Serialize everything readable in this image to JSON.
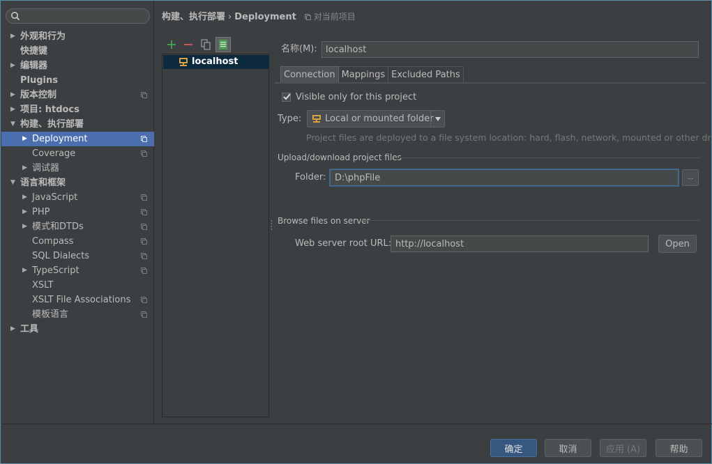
{
  "search": {
    "placeholder": ""
  },
  "sidebar": {
    "items": [
      {
        "label": "外观和行为",
        "arrow": "▶",
        "bold": true,
        "indent": 0
      },
      {
        "label": "快捷键",
        "arrow": "",
        "bold": true,
        "indent": 0
      },
      {
        "label": "编辑器",
        "arrow": "▶",
        "bold": true,
        "indent": 0
      },
      {
        "label": "Plugins",
        "arrow": "",
        "bold": true,
        "indent": 0
      },
      {
        "label": "版本控制",
        "arrow": "▶",
        "bold": true,
        "indent": 0,
        "project": true
      },
      {
        "label": "项目: htdocs",
        "arrow": "▶",
        "bold": true,
        "indent": 0
      },
      {
        "label": "构建、执行部署",
        "arrow": "▼",
        "bold": true,
        "indent": 0
      },
      {
        "label": "Deployment",
        "arrow": "▶",
        "bold": false,
        "indent": 1,
        "project": true,
        "selected": true
      },
      {
        "label": "Coverage",
        "arrow": "",
        "bold": false,
        "indent": 1,
        "project": true
      },
      {
        "label": "调试器",
        "arrow": "▶",
        "bold": false,
        "indent": 1
      },
      {
        "label": "语言和框架",
        "arrow": "▼",
        "bold": true,
        "indent": 0
      },
      {
        "label": "JavaScript",
        "arrow": "▶",
        "bold": false,
        "indent": 1,
        "project": true
      },
      {
        "label": "PHP",
        "arrow": "▶",
        "bold": false,
        "indent": 1,
        "project": true
      },
      {
        "label": "模式和DTDs",
        "arrow": "▶",
        "bold": false,
        "indent": 1,
        "project": true
      },
      {
        "label": "Compass",
        "arrow": "",
        "bold": false,
        "indent": 1,
        "project": true
      },
      {
        "label": "SQL Dialects",
        "arrow": "",
        "bold": false,
        "indent": 1,
        "project": true
      },
      {
        "label": "TypeScript",
        "arrow": "▶",
        "bold": false,
        "indent": 1,
        "project": true
      },
      {
        "label": "XSLT",
        "arrow": "",
        "bold": false,
        "indent": 1
      },
      {
        "label": "XSLT File Associations",
        "arrow": "",
        "bold": false,
        "indent": 1,
        "project": true
      },
      {
        "label": "模板语言",
        "arrow": "",
        "bold": false,
        "indent": 1,
        "project": true
      },
      {
        "label": "工具",
        "arrow": "▶",
        "bold": true,
        "indent": 0
      }
    ]
  },
  "breadcrumb": {
    "parent": "构建、执行部署",
    "separator": "›",
    "current": "Deployment",
    "scope": "对当前项目"
  },
  "servers": {
    "items": [
      {
        "label": "localhost"
      }
    ]
  },
  "form": {
    "name_label": "名称(M):",
    "name_value": "localhost",
    "tabs": [
      {
        "label": "Connection",
        "active": true
      },
      {
        "label": "Mappings",
        "active": false
      },
      {
        "label": "Excluded Paths",
        "active": false
      }
    ],
    "visible_only_label": "Visible only for this project",
    "visible_only_checked": true,
    "type_label": "Type:",
    "type_value": "Local or mounted folder",
    "type_hint": "Project files are deployed to a file system location: hard, flash, network, mounted or other drive.",
    "upload_group_title": "Upload/download project files",
    "folder_label": "Folder:",
    "folder_value": "D:\\phpFile",
    "browse_label": "...",
    "browse_group_title": "Browse files on server",
    "url_label": "Web server root URL:",
    "url_value": "http://localhost",
    "open_label": "Open"
  },
  "footer": {
    "ok_label": "确定",
    "cancel_label": "取消",
    "apply_label": "应用 (A)",
    "help_label": "帮助"
  },
  "colors": {
    "accent": "#4b6eaf",
    "add_green": "#499c54",
    "remove_red": "#c75450",
    "folder_orange": "#d9a343"
  }
}
